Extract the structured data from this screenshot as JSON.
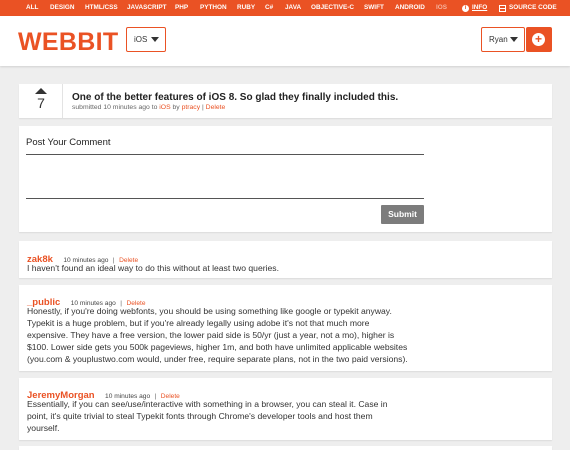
{
  "topnav": {
    "languages": [
      "ALL",
      "DESIGN",
      "HTML/CSS",
      "JAVASCRIPT",
      "PHP",
      "PYTHON",
      "RUBY",
      "C#",
      "JAVA",
      "OBJECTIVE-C",
      "SWIFT",
      "ANDROID",
      "IOS"
    ],
    "info_label": "INFO",
    "source_label": "SOURCE CODE"
  },
  "header": {
    "logo": "WEBBIT",
    "language_select": "iOS",
    "user_select": "Ryan",
    "add_icon": "plus-icon"
  },
  "post": {
    "votes": "7",
    "title": "One of the better features of iOS 8. So glad they finally included this.",
    "meta_prefix": "submitted 10 minutes ago to",
    "subreddit": "iOS",
    "by": "by",
    "author": "ptracy",
    "sep": "|",
    "delete": "Delete"
  },
  "comment_form": {
    "title": "Post Your Comment",
    "submit": "Submit"
  },
  "comments": [
    {
      "author": "zak8k",
      "time": "10 minutes ago",
      "sep": "|",
      "delete": "Delete",
      "lines": [
        "I haven't found an ideal way to do this without at least two queries."
      ]
    },
    {
      "author": "_public",
      "time": "10 minutes ago",
      "sep": "|",
      "delete": "Delete",
      "lines": [
        "Honestly, if you're doing webfonts, you should be using something like google or typekit anyway.",
        "Typekit is a huge problem, but if you're already legally using adobe it's not that much more",
        "expensive. They have a free version, the lower paid side is 50/yr (just a year, not a mo), higher is",
        "$100. Lower side gets you 500k pageviews, higher 1m, and both have unlimited applicable websites",
        "(you.com & youplustwo.com would, under free, require separate plans, not in the two paid versions)."
      ]
    },
    {
      "author": "JeremyMorgan",
      "time": "10 minutes ago",
      "sep": "|",
      "delete": "Delete",
      "lines": [
        "Essentially, if you can see/use/interactive with something in a browser, you can steal it. Case in",
        "point, it's quite trivial to steal Typekit fonts through Chrome's developer tools and host them",
        "yourself."
      ]
    }
  ],
  "colors": {
    "accent": "#ea5224",
    "background": "#eeeeee",
    "submit_bg": "#7c7c7c"
  }
}
